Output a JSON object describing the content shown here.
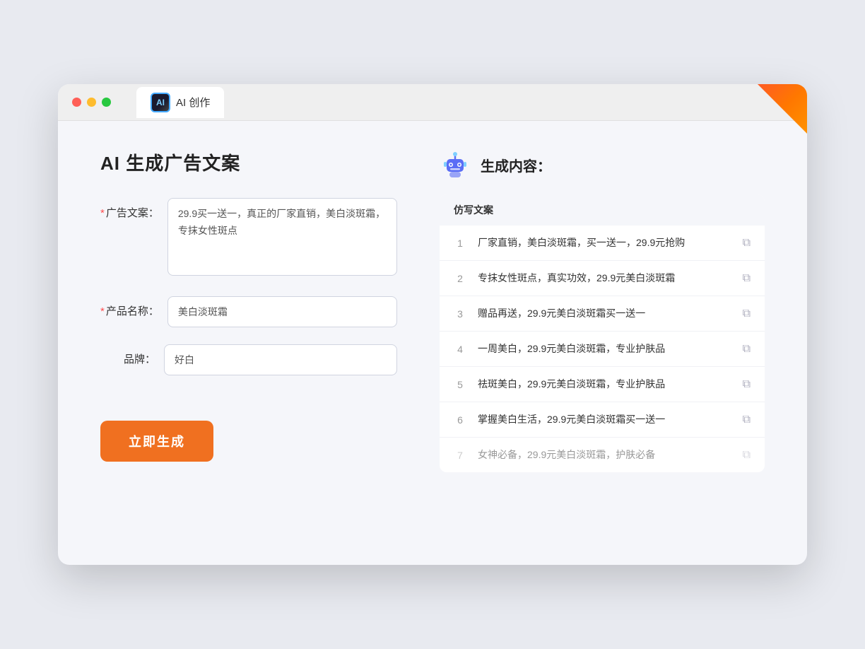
{
  "window": {
    "tab_label": "AI 创作"
  },
  "page": {
    "title": "AI 生成广告文案",
    "result_title": "生成内容："
  },
  "form": {
    "ad_copy_label": "广告文案：",
    "ad_copy_required": true,
    "ad_copy_value": "29.9买一送一，真正的厂家直销，美白淡斑霜，专抹女性斑点",
    "product_name_label": "产品名称：",
    "product_name_required": true,
    "product_name_value": "美白淡斑霜",
    "brand_label": "品牌：",
    "brand_required": false,
    "brand_value": "好白",
    "generate_button_label": "立即生成"
  },
  "results": {
    "table_header": "仿写文案",
    "items": [
      {
        "id": 1,
        "text": "厂家直销，美白淡斑霜，买一送一，29.9元抢购",
        "dimmed": false
      },
      {
        "id": 2,
        "text": "专抹女性斑点，真实功效，29.9元美白淡斑霜",
        "dimmed": false
      },
      {
        "id": 3,
        "text": "赠品再送，29.9元美白淡斑霜买一送一",
        "dimmed": false
      },
      {
        "id": 4,
        "text": "一周美白，29.9元美白淡斑霜，专业护肤品",
        "dimmed": false
      },
      {
        "id": 5,
        "text": "祛斑美白，29.9元美白淡斑霜，专业护肤品",
        "dimmed": false
      },
      {
        "id": 6,
        "text": "掌握美白生活，29.9元美白淡斑霜买一送一",
        "dimmed": false
      },
      {
        "id": 7,
        "text": "女神必备，29.9元美白淡斑霜，护肤必备",
        "dimmed": true
      }
    ]
  },
  "icons": {
    "copy": "⧉",
    "ai_logo": "AI"
  }
}
